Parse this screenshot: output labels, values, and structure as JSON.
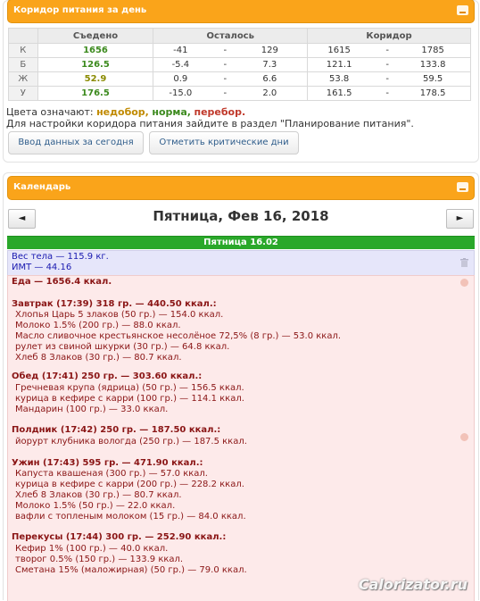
{
  "corridor_panel": {
    "title": "Коридор питания за день",
    "columns": [
      "Съедено",
      "Осталось",
      "Коридор"
    ],
    "rows": [
      {
        "label": "К",
        "eaten": "1656",
        "left_min": "-41",
        "left_max": "129",
        "corr_min": "1615",
        "corr_max": "1785"
      },
      {
        "label": "Б",
        "eaten": "126.5",
        "left_min": "-5.4",
        "left_max": "7.3",
        "corr_min": "121.1",
        "corr_max": "133.8"
      },
      {
        "label": "Ж",
        "eaten": "52.9",
        "left_min": "0.9",
        "left_max": "6.6",
        "corr_min": "53.8",
        "corr_max": "59.5"
      },
      {
        "label": "У",
        "eaten": "176.5",
        "left_min": "-15.0",
        "left_max": "2.0",
        "corr_min": "161.5",
        "corr_max": "178.5"
      }
    ],
    "dash": "-",
    "legend_prefix": "Цвета означают:",
    "legend_under": "недобор,",
    "legend_norm": "норма,",
    "legend_over": "перебор.",
    "settings_note": "Для настройки коридора питания зайдите в раздел \"Планирование питания\".",
    "btn_today": "Ввод данных за сегодня",
    "btn_critical": "Отметить критические дни"
  },
  "calendar_panel": {
    "title": "Календарь",
    "prev": "◄",
    "next": "►",
    "date": "Пятница, Фев 16, 2018",
    "day_bar": "Пятница 16.02",
    "weight_line": "Вес тела — 115.9 кг.",
    "bmi_line": "ИМТ — 44.16",
    "food_total": "Еда — 1656.4 ккал.",
    "meals": [
      {
        "header": "Завтрак (17:39) 318 гр. — 440.50 ккал.:",
        "items": [
          "Хлопья Царь 5 злаков (50 гр.) — 154.0 ккал.",
          "Молоко 1.5% (200 гр.) — 88.0 ккал.",
          "Масло сливочное крестьянское несолёное 72,5% (8 гр.) — 53.0 ккал.",
          "рулет из свиной шкурки (30 гр.) — 64.8 ккал.",
          "Хлеб 8 Злаков (30 гр.) — 80.7 ккал."
        ]
      },
      {
        "header": "Обед (17:41) 250 гр. — 303.60 ккал.:",
        "items": [
          "Гречневая крупа (ядрица) (50 гр.) — 156.5 ккал.",
          "курица в кефире с карри (100 гр.) — 114.1 ккал.",
          "Мандарин (100 гр.) — 33.0 ккал."
        ]
      },
      {
        "header": "Полдник (17:42) 250 гр. — 187.50 ккал.:",
        "items": [
          "йорурт клубника вологда (250 гр.) — 187.5 ккал."
        ]
      },
      {
        "header": "Ужин (17:43) 595 гр. — 471.90 ккал.:",
        "items": [
          "Капуста квашеная (300 гр.) — 57.0 ккал.",
          "курица в кефире с карри (200 гр.) — 228.2 ккал.",
          "Хлеб 8 Злаков (30 гр.) — 80.7 ккал.",
          "Молоко 1.5% (50 гр.) — 22.0 ккал.",
          "вафли с топленым молоком (15 гр.) — 84.0 ккал."
        ]
      },
      {
        "header": "Перекусы (17:44) 300 гр. — 252.90 ккал.:",
        "items": [
          "Кефир 1% (100 гр.) — 40.0 ккал.",
          "творог 0.5% (150 гр.) — 133.9 ккал.",
          "Сметана 15% (маложирная) (50 гр.) — 79.0 ккал."
        ]
      }
    ]
  },
  "watermark": "Calorizator.ru",
  "colors": {
    "accent": "#faa41a",
    "day_bar": "#2aa82a",
    "food_bg": "#fdeaea",
    "weight_bg": "#e6e6fa"
  }
}
